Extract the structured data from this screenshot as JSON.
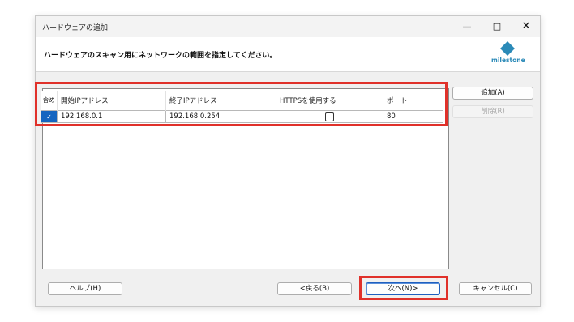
{
  "window": {
    "title": "ハードウェアの追加",
    "instruction": "ハードウェアのスキャン用にネットワークの範囲を指定してください。",
    "controls": {
      "minimize": "—",
      "maximize": "□",
      "close": "✕"
    }
  },
  "logo": {
    "text": "milestone",
    "color": "#2b8ab8"
  },
  "table": {
    "headers": [
      "含め",
      "開始IPアドレス",
      "終了IPアドレス",
      "HTTPSを使用する",
      "ポート"
    ],
    "rows": [
      {
        "include": true,
        "start_ip": "192.168.0.1",
        "end_ip": "192.168.0.254",
        "https": false,
        "port": "80"
      }
    ]
  },
  "side_buttons": {
    "add": "追加(A)",
    "remove": "削除(R)"
  },
  "footer": {
    "help": "ヘルプ(H)",
    "back": "<戻る(B)",
    "next": "次へ(N)>",
    "cancel": "キャンセル(C)"
  },
  "colors": {
    "highlight": "#e0312a",
    "selection": "#1565c0"
  }
}
